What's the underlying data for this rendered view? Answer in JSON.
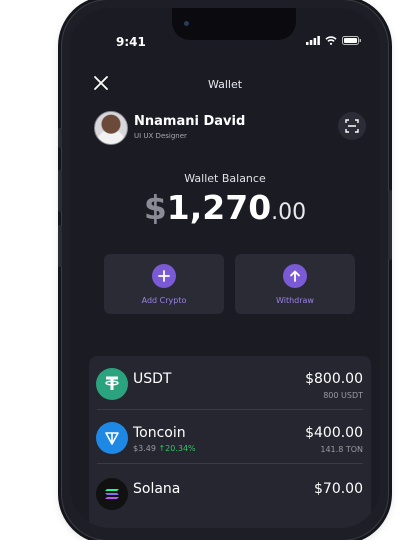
{
  "status": {
    "time": "9:41"
  },
  "header": {
    "title": "Wallet"
  },
  "profile": {
    "name": "Nnamani David",
    "role": "UI UX Designer"
  },
  "balance": {
    "label": "Wallet Balance",
    "currency": "$",
    "integer": "1,270",
    "decimal": ".00"
  },
  "actions": [
    {
      "label": "Add Crypto",
      "icon": "plus-icon"
    },
    {
      "label": "Withdraw",
      "icon": "arrow-up-icon"
    }
  ],
  "assets": [
    {
      "name": "USDT",
      "price": "",
      "change": "",
      "value": "$800.00",
      "holding": "800 USDT",
      "icon": "tether-icon",
      "color": "#2aa37e"
    },
    {
      "name": "Toncoin",
      "price": "$3.49",
      "change": "↑20.34%",
      "value": "$400.00",
      "holding": "141.8 TON",
      "icon": "toncoin-icon",
      "color": "#1e88e5"
    },
    {
      "name": "Solana",
      "price": "",
      "change": "",
      "value": "$70.00",
      "holding": "",
      "icon": "solana-icon",
      "color": "#111111"
    }
  ],
  "colors": {
    "accent": "#7b5ad6",
    "positive": "#36c26a",
    "background": "#1b1b23"
  }
}
